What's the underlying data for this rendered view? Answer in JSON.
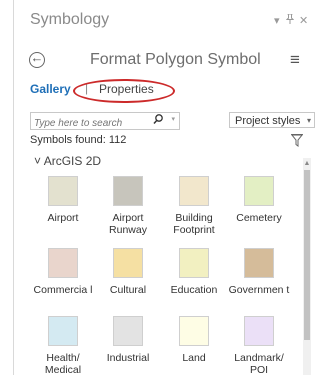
{
  "pane": {
    "title": "Symbology",
    "pin_glyph": "▾",
    "pushpin_glyph": "ᵖ",
    "close_glyph": "✕"
  },
  "header": {
    "back_glyph": "←",
    "title": "Format Polygon Symbol",
    "menu_glyph": "≡"
  },
  "tabs": {
    "gallery": "Gallery",
    "separator": "|",
    "properties": "Properties",
    "active": "Gallery"
  },
  "search": {
    "placeholder": "Type here to search",
    "search_glyph": "⚲",
    "dropdown_glyph": "▾"
  },
  "styles_dropdown": {
    "value": "Project styles",
    "arrow": "▾"
  },
  "symbols_found": "Symbols found: 112",
  "group": {
    "expander": "˅",
    "name": "ArcGIS 2D"
  },
  "symbols": [
    {
      "label": "Airport",
      "color": "#e3e1cf"
    },
    {
      "label": "Airport Runway",
      "color": "#c7c5bc"
    },
    {
      "label": "Building Footprint",
      "color": "#f2e7cc"
    },
    {
      "label": "Cemetery",
      "color": "#e3efc4"
    },
    {
      "label": "Commercia l",
      "color": "#e9d5cc"
    },
    {
      "label": "Cultural",
      "color": "#f5e0a3"
    },
    {
      "label": "Education",
      "color": "#f2f0c1"
    },
    {
      "label": "Governmen t",
      "color": "#d5bc9a"
    },
    {
      "label": "Health/ Medical",
      "color": "#d4eaf2"
    },
    {
      "label": "Industrial",
      "color": "#e3e3e3"
    },
    {
      "label": "Land",
      "color": "#fefde5"
    },
    {
      "label": "Landmark/ POI",
      "color": "#ebe0f7"
    }
  ],
  "colors": {
    "accent": "#1f6fb7",
    "highlight_circle": "#cc2a2a"
  }
}
